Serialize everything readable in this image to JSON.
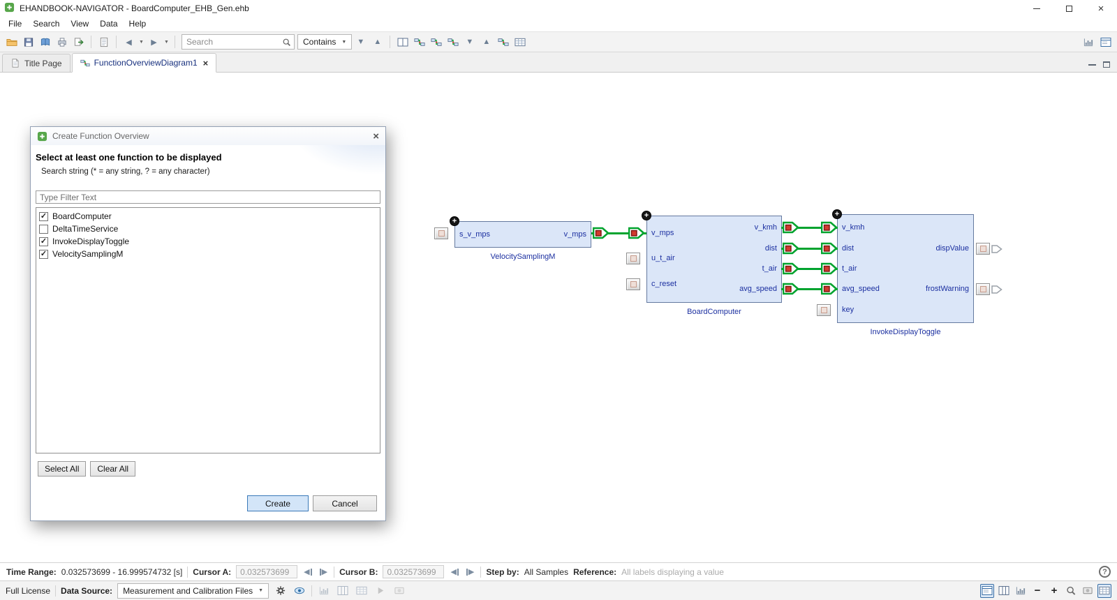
{
  "window": {
    "title": "EHANDBOOK-NAVIGATOR - BoardComputer_EHB_Gen.ehb"
  },
  "menu": {
    "items": [
      "File",
      "Search",
      "View",
      "Data",
      "Help"
    ]
  },
  "toolbar": {
    "search_placeholder": "Search",
    "contains_label": "Contains"
  },
  "tabs": [
    {
      "label": "Title Page"
    },
    {
      "label": "FunctionOverviewDiagram1"
    }
  ],
  "dialog": {
    "title": "Create Function Overview",
    "heading": "Select at least one function to be displayed",
    "hint": "Search string (* = any string, ? = any character)",
    "filter_placeholder": "Type Filter Text",
    "functions": [
      {
        "label": "BoardComputer",
        "checked": true
      },
      {
        "label": "DeltaTimeService",
        "checked": false
      },
      {
        "label": "InvokeDisplayToggle",
        "checked": true
      },
      {
        "label": "VelocitySamplingM",
        "checked": true
      }
    ],
    "buttons": {
      "select_all": "Select All",
      "clear_all": "Clear All",
      "create": "Create",
      "cancel": "Cancel"
    }
  },
  "diagram": {
    "blocks": [
      {
        "name": "VelocitySamplingM",
        "inputs": [
          "s_v_mps"
        ],
        "outputs": [
          "v_mps"
        ]
      },
      {
        "name": "BoardComputer",
        "inputs": [
          "v_mps",
          "u_t_air",
          "c_reset"
        ],
        "outputs": [
          "v_kmh",
          "dist",
          "t_air",
          "avg_speed"
        ]
      },
      {
        "name": "InvokeDisplayToggle",
        "inputs": [
          "v_kmh",
          "dist",
          "t_air",
          "avg_speed",
          "key"
        ],
        "outputs": [
          "dispValue",
          "frostWarning"
        ]
      }
    ]
  },
  "statusbar": {
    "time_range_label": "Time Range:",
    "time_range_value": "0.032573699 - 16.999574732 [s]",
    "cursor_a_label": "Cursor A:",
    "cursor_a_value": "0.032573699",
    "cursor_b_label": "Cursor B:",
    "cursor_b_value": "0.032573699",
    "step_by_label": "Step by:",
    "step_by_value": "All Samples",
    "reference_label": "Reference:",
    "reference_value": "All labels displaying a value"
  },
  "bottombar": {
    "license": "Full License",
    "data_source_label": "Data Source:",
    "data_source_value": "Measurement and Calibration Files"
  },
  "icons": {
    "close": "×",
    "caret_down": "▼",
    "nav_back": "◀",
    "nav_forward": "▶",
    "find_next": "▼",
    "find_prev": "▲",
    "step_back": "◀",
    "step_forward": "▶",
    "zoom_out": "−",
    "zoom_in": "+",
    "help": "?",
    "plus": "+",
    "check": "✓"
  },
  "colors": {
    "connection_green": "#00a32e",
    "port_red": "#d23b2f",
    "block_fill": "#dbe6f8",
    "block_border": "#64799f",
    "diagram_label": "#1b2fa0",
    "create_button_border": "#3a79b8"
  }
}
